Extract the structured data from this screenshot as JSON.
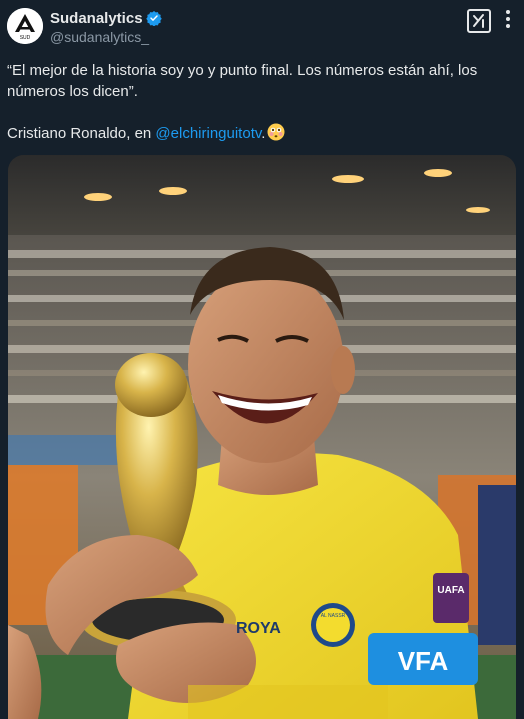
{
  "author": {
    "display_name": "Sudanalytics",
    "handle": "@sudanalytics_",
    "verified": true,
    "avatar_icon": "sudanalytics-logo",
    "avatar_letters": "SUD"
  },
  "header_actions": {
    "grok_icon": "grok-icon",
    "more_icon": "more-vertical-icon"
  },
  "tweet": {
    "quote_line": "“El mejor de la historia soy yo y punto final. Los números están ahí, los números los dicen”.",
    "credit_prefix": "Cristiano Ronaldo, en ",
    "mention": "@elchiringuitotv",
    "credit_suffix": ".",
    "emoji": "flushed-face-emoji"
  },
  "media": {
    "kind": "photo",
    "jersey_sponsor": "ROYA",
    "crest_text": "AL NASSR",
    "sleeve_badge": "UAFA",
    "armband_text": "VFA",
    "colors": {
      "jersey": "#f3dc2e",
      "armband": "#1e8fe0",
      "trophy": "#c9a43a",
      "crowd_bg": "#3a3a3a"
    }
  },
  "colors": {
    "background": "#15202b",
    "text_primary": "#e7e9ea",
    "text_secondary": "#8b98a5",
    "link": "#1d9bf0",
    "verified": "#1d9bf0"
  }
}
